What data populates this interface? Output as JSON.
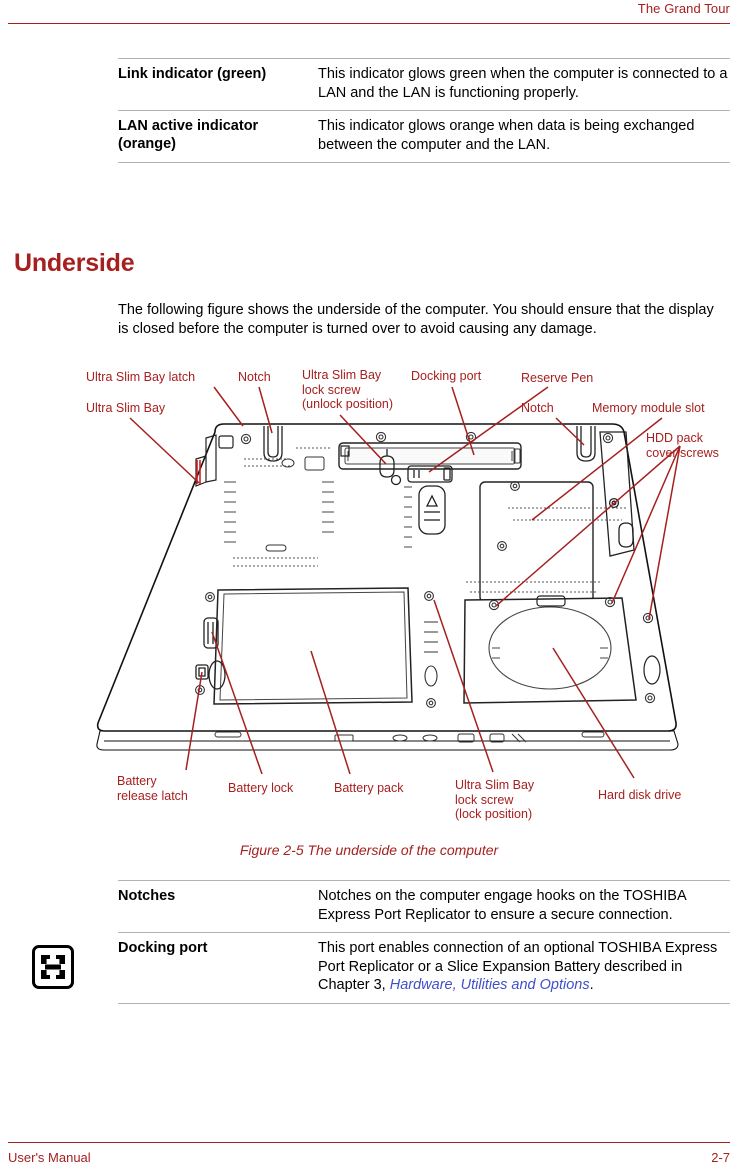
{
  "header": {
    "title": "The Grand Tour"
  },
  "footer": {
    "left": "User's Manual",
    "right": "2-7"
  },
  "section": {
    "heading": "Underside",
    "intro": "The following figure shows the underside of the computer. You should ensure that the display is closed before the computer is turned over to avoid causing any damage."
  },
  "indicator_table": {
    "rows": [
      {
        "term": "Link indicator (green)",
        "desc": "This indicator glows green when the computer is connected to a LAN and the LAN is functioning properly."
      },
      {
        "term": "LAN active indicator (orange)",
        "desc": "This indicator glows orange when data is being exchanged between the computer and the LAN."
      }
    ]
  },
  "underside_table": {
    "rows": [
      {
        "icon": "",
        "term": "Notches",
        "desc": "Notches on the computer engage hooks on the TOSHIBA Express Port Replicator to ensure a secure connection."
      },
      {
        "icon": "docking-port-icon",
        "term": "Docking port",
        "desc_part1": "This port enables connection of an optional TOSHIBA Express Port Replicator or a Slice Expansion Battery described in Chapter 3, ",
        "desc_emphasis": "Hardware, Utilities and Options",
        "desc_part2": "."
      }
    ]
  },
  "figure": {
    "caption": "Figure 2-5 The underside of the computer",
    "callouts": [
      {
        "id": "ultra-slim-bay-latch",
        "text": "Ultra Slim Bay latch"
      },
      {
        "id": "notch-left",
        "text": "Notch"
      },
      {
        "id": "ultra-slim-bay-lock-screw-unlock",
        "text": "Ultra Slim Bay\nlock screw\n(unlock position)"
      },
      {
        "id": "docking-port",
        "text": "Docking port"
      },
      {
        "id": "reserve-pen",
        "text": "Reserve Pen"
      },
      {
        "id": "ultra-slim-bay",
        "text": "Ultra Slim Bay"
      },
      {
        "id": "notch-right",
        "text": "Notch"
      },
      {
        "id": "memory-module-slot",
        "text": "Memory module slot"
      },
      {
        "id": "hdd-pack-cover-screws",
        "text": "HDD pack\ncover screws"
      },
      {
        "id": "battery-release-latch",
        "text": "Battery\nrelease latch"
      },
      {
        "id": "battery-lock",
        "text": "Battery lock"
      },
      {
        "id": "battery-pack",
        "text": "Battery pack"
      },
      {
        "id": "ultra-slim-bay-lock-screw-lock",
        "text": "Ultra Slim Bay\nlock screw\n(lock position)"
      },
      {
        "id": "hard-disk-drive",
        "text": "Hard disk drive"
      }
    ]
  },
  "colors": {
    "accent_red": "#a62020",
    "link_blue": "#4050c8",
    "rule_gray": "#b3b3b3",
    "body_black": "#000000"
  }
}
